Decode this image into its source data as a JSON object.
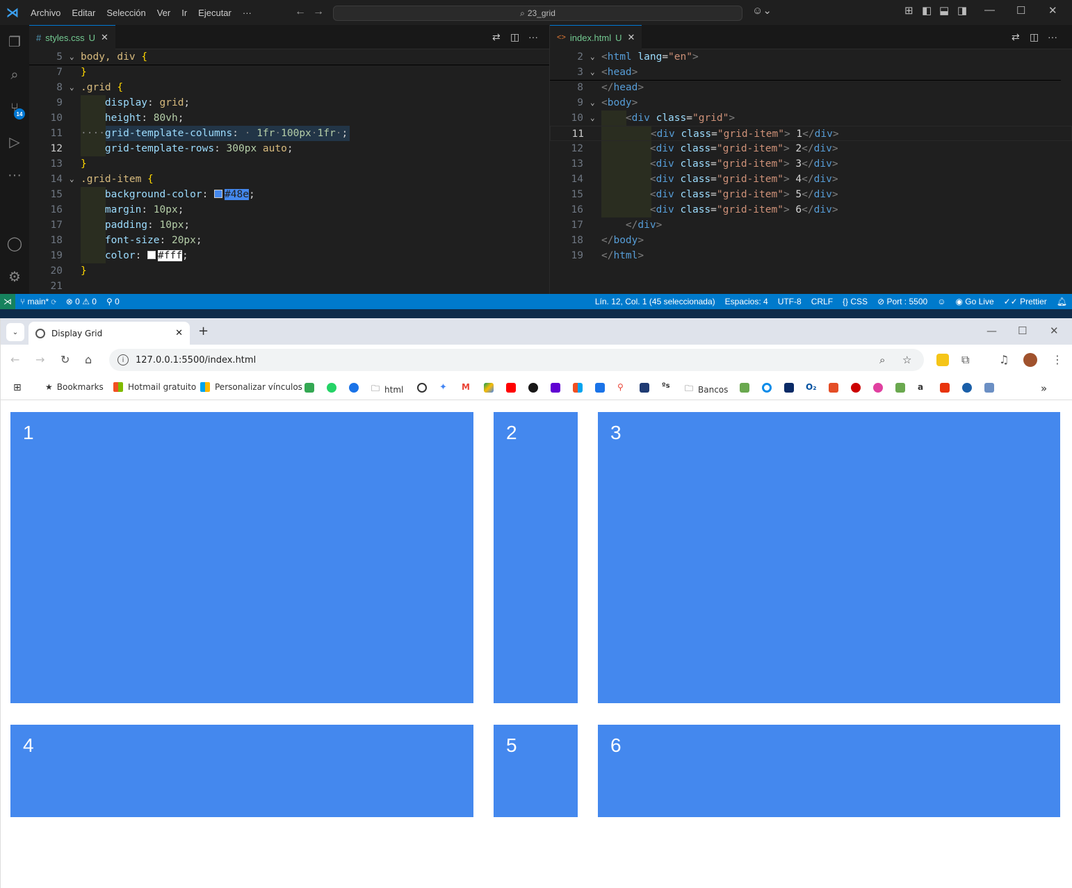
{
  "vscode": {
    "menu": [
      "Archivo",
      "Editar",
      "Selección",
      "Ver",
      "Ir",
      "Ejecutar",
      "···"
    ],
    "command_center": "23_grid",
    "activity_badge": "14",
    "left_tab": {
      "name": "styles.css",
      "status": "U",
      "icon": "#"
    },
    "right_tab": {
      "name": "index.html",
      "status": "U",
      "icon": "<>"
    },
    "css_lines": [
      {
        "n": "5",
        "fold": "v",
        "segs": [
          [
            "kw",
            "body, div "
          ],
          [
            "br",
            "{"
          ]
        ]
      },
      {
        "n": "7",
        "segs": [
          [
            "br",
            "}"
          ]
        ]
      },
      {
        "n": "8",
        "fold": "v",
        "segs": [
          [
            "kw",
            ".grid "
          ],
          [
            "br",
            "{"
          ]
        ]
      },
      {
        "n": "9",
        "segs": [
          [
            "txt",
            "    "
          ],
          [
            "pr",
            "display"
          ],
          [
            "txt",
            ": "
          ],
          [
            "kw",
            "grid"
          ],
          [
            "txt",
            ";"
          ]
        ]
      },
      {
        "n": "10",
        "segs": [
          [
            "txt",
            "    "
          ],
          [
            "pr",
            "height"
          ],
          [
            "txt",
            ": "
          ],
          [
            "vl",
            "80vh"
          ],
          [
            "txt",
            ";"
          ]
        ]
      },
      {
        "n": "11",
        "segs": [
          [
            "gr",
            "····"
          ],
          [
            "pr",
            "grid-template-columns"
          ],
          [
            "txt",
            ": "
          ],
          [
            "gr",
            "·"
          ],
          [
            "txt",
            " "
          ],
          [
            "vl",
            "1fr"
          ],
          [
            "gr",
            "·"
          ],
          [
            "vl",
            "100px"
          ],
          [
            "gr",
            "·"
          ],
          [
            "vl",
            "1fr"
          ],
          [
            "gr",
            "·"
          ],
          [
            "txt",
            ";"
          ]
        ]
      },
      {
        "n": "12",
        "cur": true,
        "segs": [
          [
            "txt",
            "    "
          ],
          [
            "pr",
            "grid-template-rows"
          ],
          [
            "txt",
            ": "
          ],
          [
            "vl",
            "300px"
          ],
          [
            "txt",
            " "
          ],
          [
            "kw",
            "auto"
          ],
          [
            "txt",
            ";"
          ]
        ]
      },
      {
        "n": "13",
        "segs": [
          [
            "br",
            "}"
          ]
        ]
      },
      {
        "n": "14",
        "fold": "v",
        "segs": [
          [
            "kw",
            ".grid-item "
          ],
          [
            "br",
            "{"
          ]
        ]
      },
      {
        "n": "15",
        "segs": [
          [
            "txt",
            "    "
          ],
          [
            "pr",
            "background-color"
          ],
          [
            "txt",
            ": "
          ],
          [
            "sw",
            "#4488ee"
          ],
          [
            "selv",
            "#48e"
          ],
          [
            "txt",
            ";"
          ]
        ]
      },
      {
        "n": "16",
        "segs": [
          [
            "txt",
            "    "
          ],
          [
            "pr",
            "margin"
          ],
          [
            "txt",
            ": "
          ],
          [
            "vl",
            "10px"
          ],
          [
            "txt",
            ";"
          ]
        ]
      },
      {
        "n": "17",
        "segs": [
          [
            "txt",
            "    "
          ],
          [
            "pr",
            "padding"
          ],
          [
            "txt",
            ": "
          ],
          [
            "vl",
            "10px"
          ],
          [
            "txt",
            ";"
          ]
        ]
      },
      {
        "n": "18",
        "segs": [
          [
            "txt",
            "    "
          ],
          [
            "pr",
            "font-size"
          ],
          [
            "txt",
            ": "
          ],
          [
            "vl",
            "20px"
          ],
          [
            "txt",
            ";"
          ]
        ]
      },
      {
        "n": "19",
        "segs": [
          [
            "txt",
            "    "
          ],
          [
            "pr",
            "color"
          ],
          [
            "txt",
            ": "
          ],
          [
            "sw",
            "#ffffff"
          ],
          [
            "selw",
            "#fff"
          ],
          [
            "txt",
            ";"
          ]
        ]
      },
      {
        "n": "20",
        "segs": [
          [
            "br",
            "}"
          ]
        ]
      },
      {
        "n": "21",
        "segs": []
      }
    ],
    "html_lines": [
      {
        "n": "2",
        "fold": "v",
        "segs": [
          [
            "gr",
            "<"
          ],
          [
            "tg",
            "html"
          ],
          [
            "txt",
            " "
          ],
          [
            "at",
            "lang"
          ],
          [
            "txt",
            "="
          ],
          [
            "st",
            "\"en\""
          ],
          [
            "gr",
            ">"
          ]
        ]
      },
      {
        "n": "3",
        "fold": "v",
        "segs": [
          [
            "gr",
            "<"
          ],
          [
            "tg",
            "head"
          ],
          [
            "gr",
            ">"
          ]
        ]
      },
      {
        "n": "8",
        "segs": [
          [
            "gr",
            "</"
          ],
          [
            "tg",
            "head"
          ],
          [
            "gr",
            ">"
          ]
        ]
      },
      {
        "n": "9",
        "fold": "v",
        "segs": [
          [
            "gr",
            "<"
          ],
          [
            "tg",
            "body"
          ],
          [
            "gr",
            ">"
          ]
        ]
      },
      {
        "n": "10",
        "fold": "v",
        "segs": [
          [
            "txt",
            "    "
          ],
          [
            "gr",
            "<"
          ],
          [
            "tg",
            "div"
          ],
          [
            "txt",
            " "
          ],
          [
            "at",
            "class"
          ],
          [
            "txt",
            "="
          ],
          [
            "st",
            "\"grid\""
          ],
          [
            "gr",
            ">"
          ]
        ]
      },
      {
        "n": "11",
        "cur": true,
        "segs": [
          [
            "txt",
            "        "
          ],
          [
            "gr",
            "<"
          ],
          [
            "tg",
            "div"
          ],
          [
            "txt",
            " "
          ],
          [
            "at",
            "class"
          ],
          [
            "txt",
            "="
          ],
          [
            "st",
            "\"grid-item\""
          ],
          [
            "gr",
            ">"
          ],
          [
            "txt",
            " 1"
          ],
          [
            "gr",
            "</"
          ],
          [
            "tg",
            "div"
          ],
          [
            "gr",
            ">"
          ]
        ]
      },
      {
        "n": "12",
        "segs": [
          [
            "txt",
            "        "
          ],
          [
            "gr",
            "<"
          ],
          [
            "tg",
            "div"
          ],
          [
            "txt",
            " "
          ],
          [
            "at",
            "class"
          ],
          [
            "txt",
            "="
          ],
          [
            "st",
            "\"grid-item\""
          ],
          [
            "gr",
            ">"
          ],
          [
            "txt",
            " 2"
          ],
          [
            "gr",
            "</"
          ],
          [
            "tg",
            "div"
          ],
          [
            "gr",
            ">"
          ]
        ]
      },
      {
        "n": "13",
        "segs": [
          [
            "txt",
            "        "
          ],
          [
            "gr",
            "<"
          ],
          [
            "tg",
            "div"
          ],
          [
            "txt",
            " "
          ],
          [
            "at",
            "class"
          ],
          [
            "txt",
            "="
          ],
          [
            "st",
            "\"grid-item\""
          ],
          [
            "gr",
            ">"
          ],
          [
            "txt",
            " 3"
          ],
          [
            "gr",
            "</"
          ],
          [
            "tg",
            "div"
          ],
          [
            "gr",
            ">"
          ]
        ]
      },
      {
        "n": "14",
        "segs": [
          [
            "txt",
            "        "
          ],
          [
            "gr",
            "<"
          ],
          [
            "tg",
            "div"
          ],
          [
            "txt",
            " "
          ],
          [
            "at",
            "class"
          ],
          [
            "txt",
            "="
          ],
          [
            "st",
            "\"grid-item\""
          ],
          [
            "gr",
            ">"
          ],
          [
            "txt",
            " 4"
          ],
          [
            "gr",
            "</"
          ],
          [
            "tg",
            "div"
          ],
          [
            "gr",
            ">"
          ]
        ]
      },
      {
        "n": "15",
        "segs": [
          [
            "txt",
            "        "
          ],
          [
            "gr",
            "<"
          ],
          [
            "tg",
            "div"
          ],
          [
            "txt",
            " "
          ],
          [
            "at",
            "class"
          ],
          [
            "txt",
            "="
          ],
          [
            "st",
            "\"grid-item\""
          ],
          [
            "gr",
            ">"
          ],
          [
            "txt",
            " 5"
          ],
          [
            "gr",
            "</"
          ],
          [
            "tg",
            "div"
          ],
          [
            "gr",
            ">"
          ]
        ]
      },
      {
        "n": "16",
        "segs": [
          [
            "txt",
            "        "
          ],
          [
            "gr",
            "<"
          ],
          [
            "tg",
            "div"
          ],
          [
            "txt",
            " "
          ],
          [
            "at",
            "class"
          ],
          [
            "txt",
            "="
          ],
          [
            "st",
            "\"grid-item\""
          ],
          [
            "gr",
            ">"
          ],
          [
            "txt",
            " 6"
          ],
          [
            "gr",
            "</"
          ],
          [
            "tg",
            "div"
          ],
          [
            "gr",
            ">"
          ]
        ]
      },
      {
        "n": "17",
        "segs": [
          [
            "txt",
            "    "
          ],
          [
            "gr",
            "</"
          ],
          [
            "tg",
            "div"
          ],
          [
            "gr",
            ">"
          ]
        ]
      },
      {
        "n": "18",
        "segs": [
          [
            "gr",
            "</"
          ],
          [
            "tg",
            "body"
          ],
          [
            "gr",
            ">"
          ]
        ]
      },
      {
        "n": "19",
        "segs": [
          [
            "gr",
            "</"
          ],
          [
            "tg",
            "html"
          ],
          [
            "gr",
            ">"
          ]
        ]
      }
    ],
    "status": {
      "branch": "main*",
      "errors": "0",
      "warnings": "0",
      "ports": "0",
      "position": "Lín. 12, Col. 1 (45 seleccionada)",
      "spaces": "Espacios: 4",
      "encoding": "UTF-8",
      "eol": "CRLF",
      "language": "CSS",
      "port": "Port : 5500",
      "golive": "Go Live",
      "prettier": "Prettier"
    }
  },
  "browser": {
    "tab_title": "Display Grid",
    "url": "127.0.0.1:5500/index.html",
    "bookmarks": [
      "Bookmarks",
      "Hotmail gratuito",
      "Personalizar vínculos",
      "html",
      "Bancos"
    ],
    "grid_items": [
      "1",
      "2",
      "3",
      "4",
      "5",
      "6"
    ],
    "grid_color": "#4488ee"
  }
}
